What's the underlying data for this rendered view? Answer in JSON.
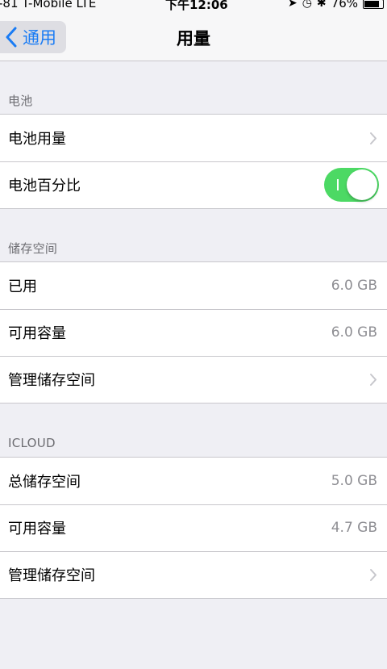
{
  "status_bar": {
    "carrier": "-81 T-Mobile  LTE",
    "time": "下午12:06",
    "battery_percent": "76%",
    "icons": [
      "location-arrow-icon",
      "alarm-icon",
      "bluetooth-icon",
      "battery-icon"
    ]
  },
  "nav": {
    "back_label": "通用",
    "title": "用量"
  },
  "sections": {
    "battery": {
      "header": "电池",
      "rows": [
        {
          "label": "电池用量"
        },
        {
          "label": "电池百分比",
          "toggle": true
        }
      ]
    },
    "storage": {
      "header": "储存空间",
      "rows": [
        {
          "label": "已用",
          "value": "6.0 GB"
        },
        {
          "label": "可用容量",
          "value": "6.0 GB"
        },
        {
          "label": "管理储存空间"
        }
      ]
    },
    "icloud": {
      "header": "ICLOUD",
      "rows": [
        {
          "label": "总储存空间",
          "value": "5.0 GB"
        },
        {
          "label": "可用容量",
          "value": "4.7 GB"
        },
        {
          "label": "管理储存空间"
        }
      ]
    }
  },
  "colors": {
    "accent": "#1a7cf4",
    "toggle_on": "#4cd964",
    "background": "#efeff4"
  }
}
